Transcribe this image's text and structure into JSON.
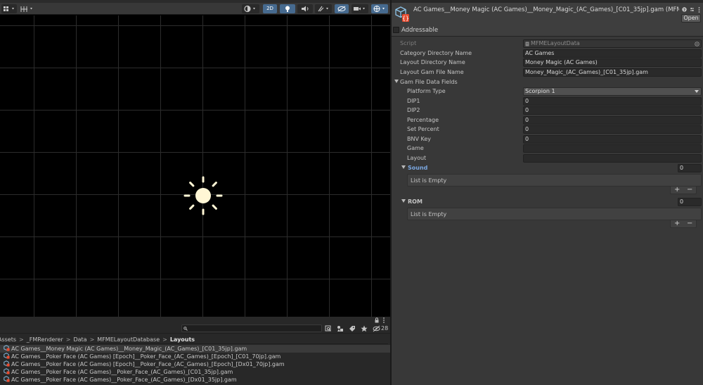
{
  "scene_toolbar": {
    "mode_2d_label": "2D"
  },
  "project": {
    "search_placeholder": "",
    "hidden_count": "28",
    "breadcrumb": [
      "Assets",
      "_FMRenderer",
      "Data",
      "MFMELayoutDatabase",
      "Layouts"
    ],
    "files": [
      "AC Games__Money Magic (AC Games)__Money_Magic_(AC_Games)_[C01_35jp].gam",
      "AC Games__Poker Face (AC Games) [Epoch]__Poker_Face_(AC_Games)_[Epoch]_[C01_70jp].gam",
      "AC Games__Poker Face (AC Games) [Epoch]__Poker_Face_(AC_Games)_[Epoch]_[Dx01_70jp].gam",
      "AC Games__Poker Face (AC Games)__Poker_Face_(AC_Games)_[C01_35jp].gam",
      "AC Games__Poker Face (AC Games)__Poker_Face_(AC_Games)_[Dx01_35jp].gam"
    ]
  },
  "inspector": {
    "title": "AC Games__Money Magic (AC Games)__Money_Magic_(AC_Games)_[C01_35jp].gam (MFM",
    "open_label": "Open",
    "addressable_label": "Addressable",
    "script_label": "Script",
    "script_value": "MFMELayoutData",
    "category_label": "Category Directory Name",
    "category_value": "AC Games",
    "layout_dir_label": "Layout Directory Name",
    "layout_dir_value": "Money Magic (AC Games)",
    "gam_file_label": "Layout Gam File Name",
    "gam_file_value": "Money_Magic_(AC_Games)_[C01_35jp].gam",
    "gam_fields_label": "Gam File Data Fields",
    "platform_label": "Platform Type",
    "platform_value": "Scorpion 1",
    "dip1_label": "DIP1",
    "dip1_value": "0",
    "dip2_label": "DIP2",
    "dip2_value": "0",
    "percentage_label": "Percentage",
    "percentage_value": "0",
    "set_percent_label": "Set Percent",
    "set_percent_value": "0",
    "bnv_label": "BNV Key",
    "bnv_value": "0",
    "game_label": "Game",
    "game_value": "",
    "layout_label": "Layout",
    "layout_value": "",
    "sound_label": "Sound",
    "sound_count": "0",
    "sound_empty": "List is Empty",
    "rom_label": "ROM",
    "rom_count": "0",
    "rom_empty": "List is Empty",
    "add_symbol": "+",
    "remove_symbol": "−"
  },
  "colors": {
    "selection_blue": "#7ba7e0",
    "toolbar_active": "#466a8f",
    "sun": "#fff6d5"
  }
}
